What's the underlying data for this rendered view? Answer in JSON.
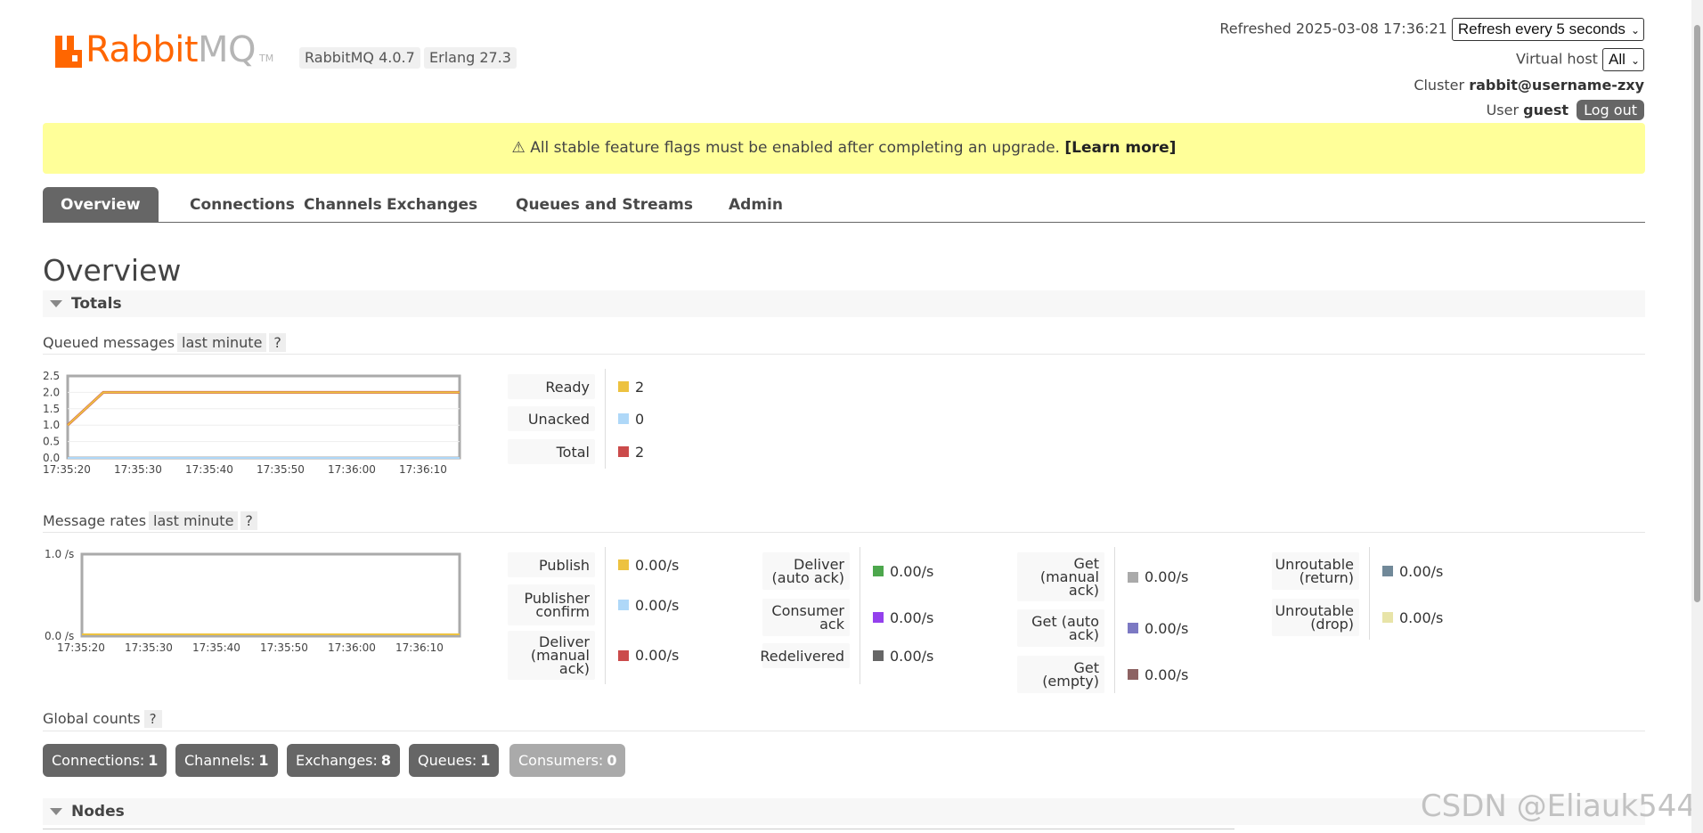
{
  "header": {
    "logo_rabbit": "Rabbit",
    "logo_mq": "MQ",
    "logo_tm": "TM",
    "version": "RabbitMQ 4.0.7",
    "erlang": "Erlang 27.3",
    "refreshed_label": "Refreshed 2025-03-08 17:36:21",
    "refresh_select": "Refresh every 5 seconds",
    "vhost_label": "Virtual host",
    "vhost_select": "All",
    "cluster_label": "Cluster",
    "cluster_name": "rabbit@username-zxy",
    "user_label": "User",
    "user_name": "guest",
    "logout": "Log out"
  },
  "notice": {
    "text": "⚠ All stable feature flags must be enabled after completing an upgrade.",
    "link": "[Learn more]"
  },
  "tabs": [
    "Overview",
    "Connections",
    "Channels",
    "Exchanges",
    "Queues and Streams",
    "Admin"
  ],
  "page_title": "Overview",
  "totals": {
    "title": "Totals",
    "queued_label": "Queued messages",
    "queued_range": "last minute",
    "help": "?",
    "queued_stats": [
      {
        "label": "Ready",
        "value": "2",
        "color": "#edc240"
      },
      {
        "label": "Unacked",
        "value": "0",
        "color": "#afd8f8"
      },
      {
        "label": "Total",
        "value": "2",
        "color": "#cb4b4b"
      }
    ],
    "rates_label": "Message rates",
    "rates_range": "last minute",
    "rates_col1": [
      {
        "label": "Publish",
        "value": "0.00/s",
        "color": "#edc240"
      },
      {
        "label": "Publisher confirm",
        "value": "0.00/s",
        "color": "#afd8f8"
      },
      {
        "label": "Deliver (manual ack)",
        "value": "0.00/s",
        "color": "#cb4b4b"
      }
    ],
    "rates_col2": [
      {
        "label": "Deliver (auto ack)",
        "value": "0.00/s",
        "color": "#4da74d"
      },
      {
        "label": "Consumer ack",
        "value": "0.00/s",
        "color": "#9440ed"
      },
      {
        "label": "Redelivered",
        "value": "0.00/s",
        "color": "#666666"
      }
    ],
    "rates_col3": [
      {
        "label": "Get (manual ack)",
        "value": "0.00/s",
        "color": "#aaaaaa"
      },
      {
        "label": "Get (auto ack)",
        "value": "0.00/s",
        "color": "#7c79c3"
      },
      {
        "label": "Get (empty)",
        "value": "0.00/s",
        "color": "#8d6262"
      }
    ],
    "rates_col4": [
      {
        "label": "Unroutable (return)",
        "value": "0.00/s",
        "color": "#718999"
      },
      {
        "label": "Unroutable (drop)",
        "value": "0.00/s",
        "color": "#e8e4a8"
      }
    ],
    "global_label": "Global counts",
    "global_counts": [
      {
        "label": "Connections:",
        "value": "1"
      },
      {
        "label": "Channels:",
        "value": "1"
      },
      {
        "label": "Exchanges:",
        "value": "8"
      },
      {
        "label": "Queues:",
        "value": "1"
      },
      {
        "label": "Consumers:",
        "value": "0"
      }
    ]
  },
  "nodes_title": "Nodes",
  "watermark": "CSDN @Eliauk544",
  "chart_data": [
    {
      "type": "line",
      "x": [
        "17:35:20",
        "17:35:25",
        "17:35:30",
        "17:35:40",
        "17:35:50",
        "17:36:00",
        "17:36:10",
        "17:36:20"
      ],
      "x_ticks": [
        "17:35:20",
        "17:35:30",
        "17:35:40",
        "17:35:50",
        "17:36:00",
        "17:36:10"
      ],
      "y_ticks": [
        "2.5",
        "2.0",
        "1.5",
        "1.0",
        "0.5",
        "0.0"
      ],
      "ylim": [
        0,
        2.5
      ],
      "series": [
        {
          "name": "Total",
          "color": "#cb4b4b",
          "values": [
            1,
            2,
            2,
            2,
            2,
            2,
            2,
            2
          ]
        },
        {
          "name": "Ready",
          "color": "#edc240",
          "values": [
            1,
            2,
            2,
            2,
            2,
            2,
            2,
            2
          ]
        },
        {
          "name": "Unacked",
          "color": "#afd8f8",
          "values": [
            0,
            0,
            0,
            0,
            0,
            0,
            0,
            0
          ]
        }
      ]
    },
    {
      "type": "line",
      "x_ticks": [
        "17:35:20",
        "17:35:30",
        "17:35:40",
        "17:35:50",
        "17:36:00",
        "17:36:10"
      ],
      "y_ticks": [
        "1.0 /s",
        "0.0 /s"
      ],
      "ylim": [
        0,
        1
      ],
      "series": [
        {
          "name": "Publish",
          "color": "#edc240",
          "values": [
            0,
            0,
            0,
            0,
            0,
            0,
            0
          ]
        }
      ]
    }
  ]
}
